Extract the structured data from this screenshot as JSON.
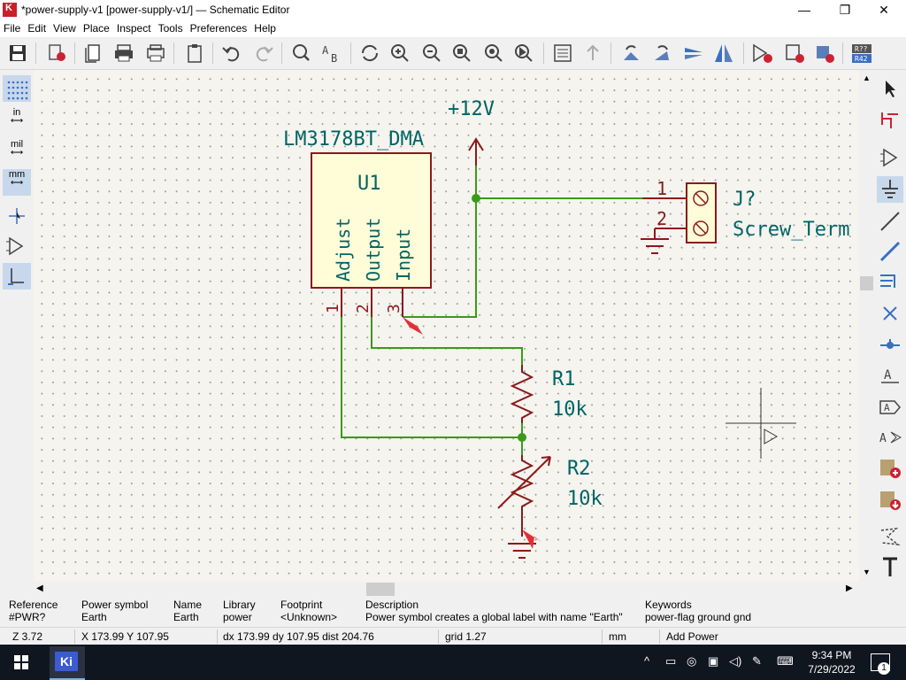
{
  "window": {
    "title": "*power-supply-v1 [power-supply-v1/] — Schematic Editor",
    "icon": "kicad-app-icon",
    "minimize": "—",
    "maximize": "❐",
    "close": "✕"
  },
  "menu": [
    "File",
    "Edit",
    "View",
    "Place",
    "Inspect",
    "Tools",
    "Preferences",
    "Help"
  ],
  "left_toolbar": {
    "units": [
      "in",
      "mil",
      "mm"
    ],
    "active_unit": "mm"
  },
  "schematic": {
    "regulator": {
      "value": "LM3178BT_DMA",
      "reference": "U1",
      "pins": [
        {
          "number": "1",
          "name": "Adjust"
        },
        {
          "number": "2",
          "name": "Output"
        },
        {
          "number": "3",
          "name": "Input"
        }
      ]
    },
    "power_label": "+12V",
    "connector": {
      "reference": "J?",
      "value": "Screw_Term",
      "pins": [
        "1",
        "2"
      ]
    },
    "r1": {
      "reference": "R1",
      "value": "10k"
    },
    "r2": {
      "reference": "R2",
      "value": "10k"
    },
    "colors": {
      "wire": "#3a9a1a",
      "component": "#8b1a1a",
      "body_fill": "#fffcd8",
      "text": "#006464",
      "junction": "#3a9a1a",
      "marker": "#e0303a"
    }
  },
  "info_panel": [
    {
      "header": "Reference",
      "value": "#PWR?"
    },
    {
      "header": "Power symbol",
      "value": "Earth"
    },
    {
      "header": "Name",
      "value": "Earth"
    },
    {
      "header": "Library",
      "value": "power"
    },
    {
      "header": "Footprint",
      "value": "<Unknown>"
    },
    {
      "header": "Description",
      "value": "Power symbol creates a global label with name \"Earth\""
    },
    {
      "header": "Keywords",
      "value": "power-flag ground gnd"
    }
  ],
  "status": {
    "zoom": "Z 3.72",
    "xy": "X 173.99  Y 107.95",
    "delta": "dx 173.99  dy 107.95  dist 204.76",
    "grid": "grid 1.27",
    "units": "mm",
    "action": "Add Power"
  },
  "taskbar": {
    "app_label": "Ki",
    "time": "9:34 PM",
    "date": "7/29/2022",
    "notification_count": "1"
  }
}
